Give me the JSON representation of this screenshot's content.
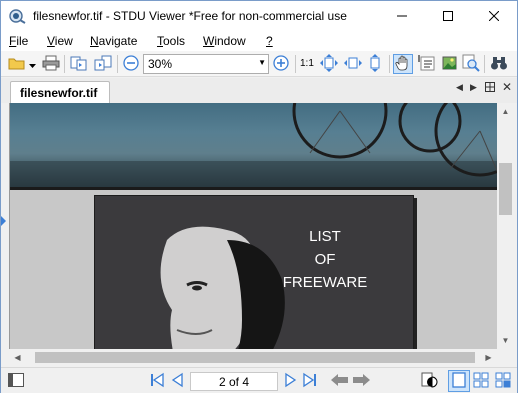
{
  "window": {
    "title": "filesnewfor.tif - STDU Viewer *Free for non-commercial use"
  },
  "menu": {
    "items": [
      {
        "label": "File",
        "accel": "F",
        "rest": "ile"
      },
      {
        "label": "View",
        "accel": "V",
        "rest": "iew"
      },
      {
        "label": "Navigate",
        "accel": "N",
        "rest": "avigate"
      },
      {
        "label": "Tools",
        "accel": "T",
        "rest": "ools"
      },
      {
        "label": "Window",
        "accel": "W",
        "rest": "indow"
      },
      {
        "label": "?",
        "accel": "?",
        "rest": ""
      }
    ]
  },
  "toolbar": {
    "zoom_value": "30%",
    "actual_size_label": "1:1"
  },
  "tabs": [
    {
      "label": "filesnewfor.tif"
    }
  ],
  "document": {
    "page2_lines": [
      "LIST",
      "OF",
      "FREEWARE"
    ]
  },
  "statusbar": {
    "page_indicator": "2 of 4",
    "current_page": 2,
    "total_pages": 4
  },
  "colors": {
    "accent": "#0078d7",
    "nav_blue": "#3c7fd6",
    "page_dark": "#3b3a3d"
  }
}
